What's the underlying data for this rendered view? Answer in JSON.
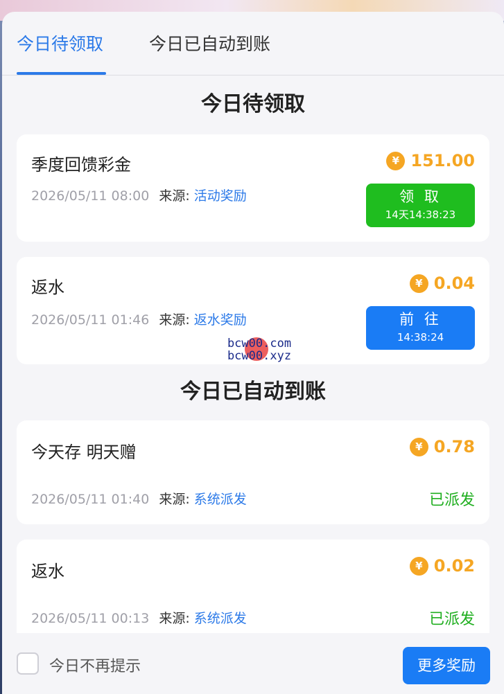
{
  "tabs": [
    {
      "label": "今日待领取",
      "active": true
    },
    {
      "label": "今日已自动到账",
      "active": false
    }
  ],
  "sections": {
    "pending_title": "今日待领取",
    "auto_title": "今日已自动到账"
  },
  "pending": [
    {
      "title": "季度回馈彩金",
      "amount": "151.00",
      "time": "2026/05/11 08:00",
      "source_label": "来源:",
      "source": "活动奖励",
      "button_label": "领 取",
      "countdown": "14天14:38:23",
      "button_color": "#1fbd1f"
    },
    {
      "title": "返水",
      "amount": "0.04",
      "time": "2026/05/11 01:46",
      "source_label": "来源:",
      "source": "返水奖励",
      "button_label": "前 往",
      "countdown": "14:38:24",
      "button_color": "#1a7cf5"
    }
  ],
  "auto": [
    {
      "title": "今天存 明天赠",
      "amount": "0.78",
      "time": "2026/05/11 01:40",
      "source_label": "来源:",
      "source": "系统派发",
      "status": "已派发"
    },
    {
      "title": "返水",
      "amount": "0.02",
      "time": "2026/05/11 00:13",
      "source_label": "来源:",
      "source": "系统派发",
      "status": "已派发"
    }
  ],
  "coin_symbol": "¥",
  "watermark": {
    "line1": "bcw00.com",
    "line2": "bcw00.xyz"
  },
  "footer": {
    "checkbox_label": "今日不再提示",
    "more_button": "更多奖励"
  },
  "colors": {
    "accent": "#2c7ae8",
    "amount": "#f5a623",
    "status": "#1fae1f"
  }
}
